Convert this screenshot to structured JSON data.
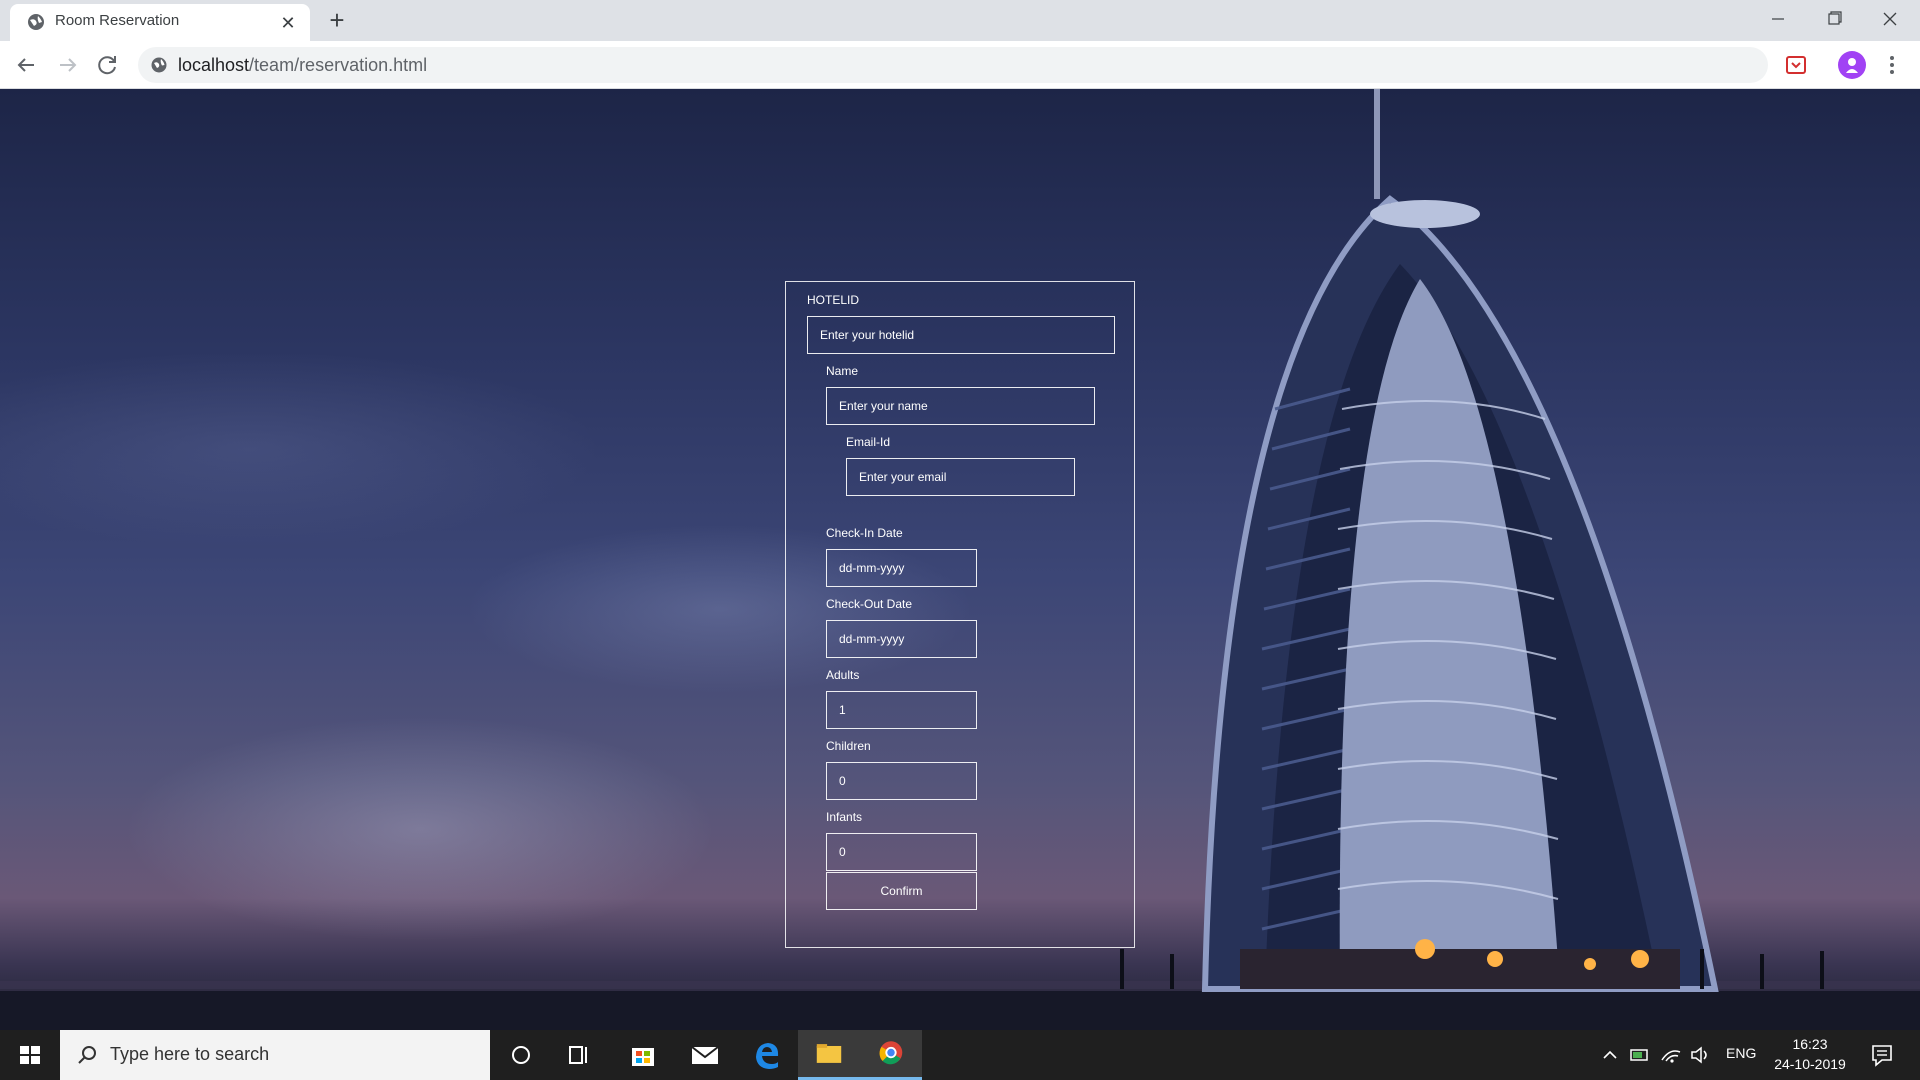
{
  "browser": {
    "tab_title": "Room Reservation",
    "address_host": "localhost",
    "address_path": "/team/reservation.html"
  },
  "form": {
    "hotelid_label": "HOTELID",
    "hotelid_placeholder": "Enter your hotelid",
    "name_label": "Name",
    "name_placeholder": "Enter your name",
    "email_label": "Email-Id",
    "email_placeholder": "Enter your email",
    "checkin_label": "Check-In Date",
    "checkin_value": "dd-mm-yyyy",
    "checkout_label": "Check-Out Date",
    "checkout_value": "dd-mm-yyyy",
    "adults_label": "Adults",
    "adults_value": "1",
    "children_label": "Children",
    "children_value": "0",
    "infants_label": "Infants",
    "infants_value": "0",
    "confirm_label": "Confirm"
  },
  "taskbar": {
    "search_placeholder": "Type here to search",
    "language": "ENG",
    "time": "16:23",
    "date": "24-10-2019"
  }
}
